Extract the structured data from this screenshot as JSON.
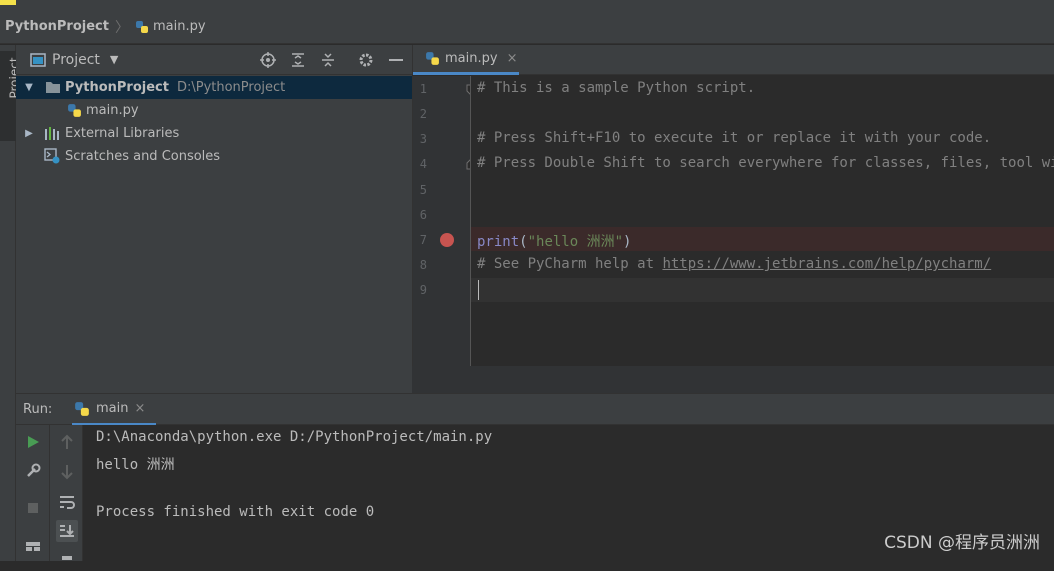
{
  "navbar": {
    "project": "PythonProject",
    "file": "main.py"
  },
  "leftstrip": {
    "tab": "Project"
  },
  "project_panel": {
    "title": "Project",
    "tree": {
      "root_label": "PythonProject",
      "root_path": "D:\\PythonProject",
      "file_label": "main.py",
      "external_libraries": "External Libraries",
      "scratches": "Scratches and Consoles"
    }
  },
  "editor": {
    "tab": "main.py",
    "line_numbers": [
      "1",
      "2",
      "3",
      "4",
      "5",
      "6",
      "7",
      "8",
      "9"
    ],
    "lines": {
      "l1": "# This is a sample Python script.",
      "l3": "# Press Shift+F10 to execute it or replace it with your code.",
      "l4": "# Press Double Shift to search everywhere for classes, files, tool windows, actions, and settings.",
      "l7_kw": "print",
      "l7_open": "(",
      "l7_str": "\"hello 洲洲\"",
      "l7_close": ")",
      "l8_prefix": "# See PyCharm help at ",
      "l8_link": "https://www.jetbrains.com/help/pycharm/"
    }
  },
  "run": {
    "label": "Run:",
    "tab": "main",
    "console": {
      "line1": "D:\\Anaconda\\python.exe D:/PythonProject/main.py",
      "line2": "hello 洲洲",
      "line3": "Process finished with exit code 0"
    }
  },
  "watermark": "CSDN @程序员洲洲",
  "colors": {
    "accent": "#4a88c7",
    "breakpoint": "#c75450",
    "selection": "#0d293e",
    "run_green": "#499c54"
  }
}
